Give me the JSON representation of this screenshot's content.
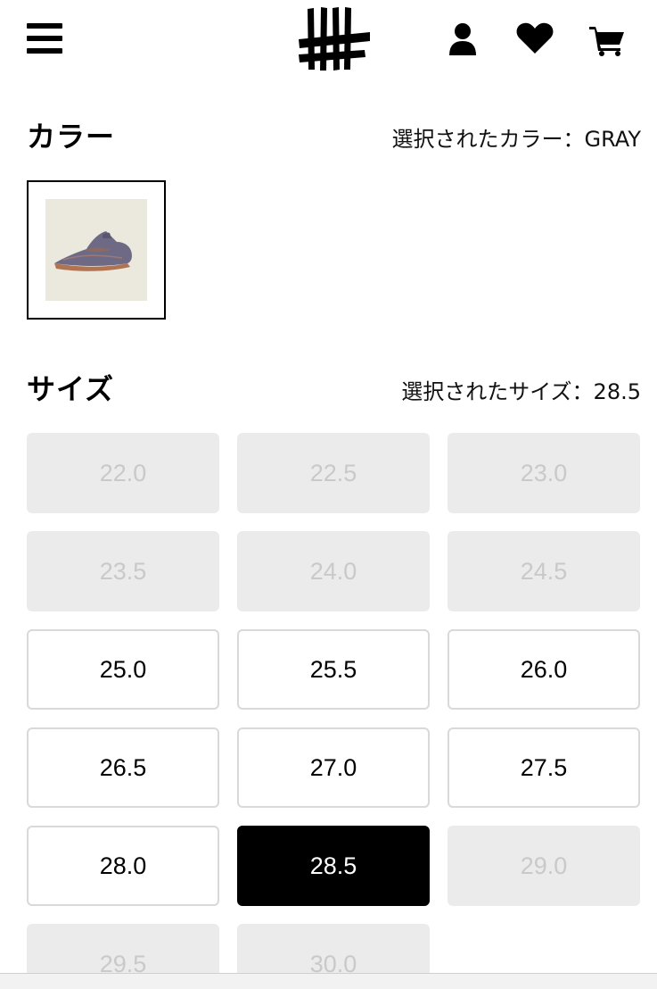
{
  "header": {
    "icons": [
      "hamburger-menu-icon",
      "brand-logo",
      "user-icon",
      "heart-icon",
      "cart-icon"
    ]
  },
  "color": {
    "title": "カラー",
    "selected_text": "選択されたカラー：GRAY",
    "swatch_image": "sneaker-thumbnail"
  },
  "size": {
    "title": "サイズ",
    "selected_text": "選択されたサイズ：28.5",
    "options": [
      {
        "label": "22.0",
        "status": "soldout"
      },
      {
        "label": "22.5",
        "status": "soldout"
      },
      {
        "label": "23.0",
        "status": "soldout"
      },
      {
        "label": "23.5",
        "status": "soldout"
      },
      {
        "label": "24.0",
        "status": "soldout"
      },
      {
        "label": "24.5",
        "status": "soldout"
      },
      {
        "label": "25.0",
        "status": "available"
      },
      {
        "label": "25.5",
        "status": "available"
      },
      {
        "label": "26.0",
        "status": "available"
      },
      {
        "label": "26.5",
        "status": "available"
      },
      {
        "label": "27.0",
        "status": "available"
      },
      {
        "label": "27.5",
        "status": "available"
      },
      {
        "label": "28.0",
        "status": "available"
      },
      {
        "label": "28.5",
        "status": "selected"
      },
      {
        "label": "29.0",
        "status": "soldout"
      },
      {
        "label": "29.5",
        "status": "soldout"
      },
      {
        "label": "30.0",
        "status": "soldout"
      }
    ]
  },
  "colors": {
    "selected_bg": "#000000",
    "soldout_bg": "#ebebeb",
    "soldout_text": "#c9c9c9",
    "available_border": "#d9d9d9"
  }
}
